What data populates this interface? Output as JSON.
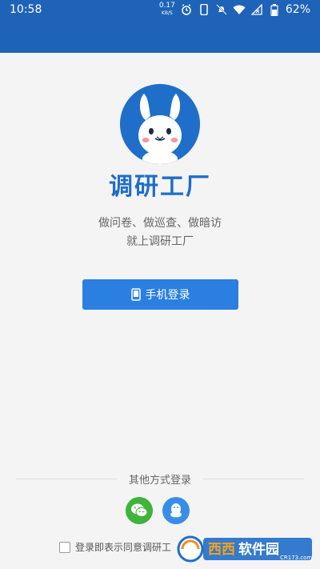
{
  "status_bar": {
    "time": "10:58",
    "net_speed_value": "0.17",
    "net_speed_unit": "KB/S",
    "battery_percent": "62%",
    "icons": [
      "alarm-icon",
      "phone-icon",
      "mute-bell-icon",
      "wifi-icon",
      "no-signal-icon",
      "battery-icon"
    ]
  },
  "app": {
    "name": "调研工厂",
    "slogan_line1": "做问卷、做巡查、做暗访",
    "slogan_line2": "就上调研工厂"
  },
  "login": {
    "phone_button_label": "手机登录"
  },
  "other_methods": {
    "label": "其他方式登录",
    "options": [
      "wechat-icon",
      "qq-icon"
    ]
  },
  "agreement": {
    "text": "登录即表示同意调研工"
  },
  "watermark": {
    "text": "西西软件园",
    "sub": "CR173.com"
  },
  "colors": {
    "header_blue": "#1f63b8",
    "brand_blue": "#1f6ec9",
    "button_blue": "#2a7fe0",
    "wechat_green": "#3fb33a",
    "qq_blue": "#3a8de6"
  }
}
